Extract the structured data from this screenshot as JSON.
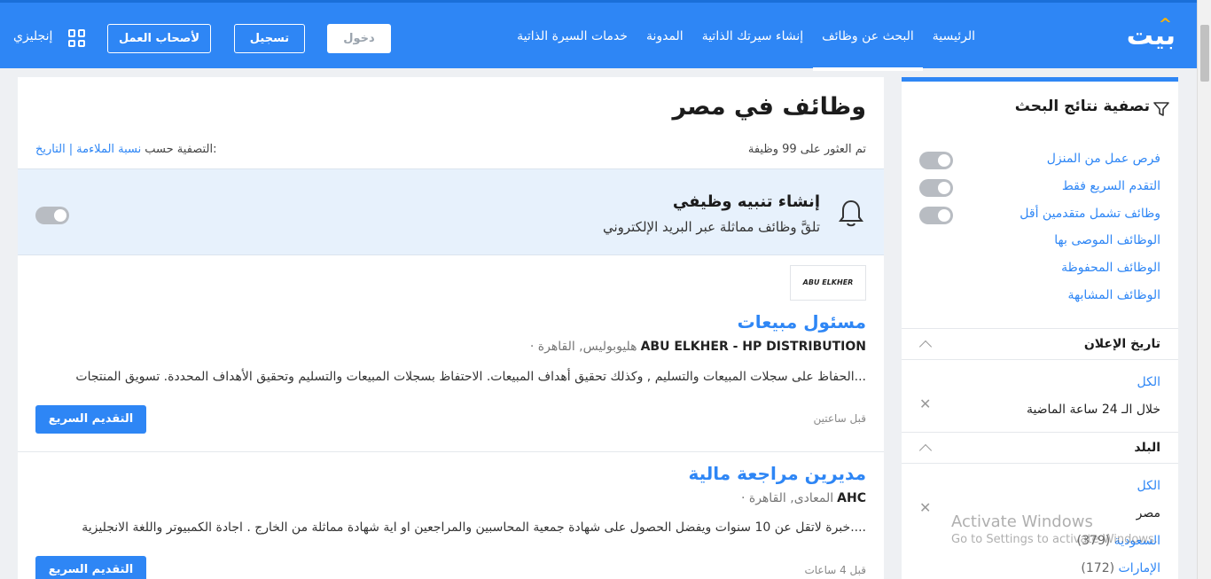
{
  "header": {
    "logo": "بيت",
    "nav": [
      "الرئيسية",
      "البحث عن وظائف",
      "إنشاء سيرتك الذاتية",
      "المدونة",
      "خدمات السيرة الذاتية"
    ],
    "active_nav_index": 1,
    "login": "دخول",
    "register": "تسجيل",
    "employers": "لأصحاب العمل",
    "language": "إنجليزي"
  },
  "main": {
    "title": "وظائف في مصر",
    "found": "تم العثور على 99 وظيفة",
    "sort_label": "التصفية حسب:",
    "sort_relevance": "نسبة الملاءمة",
    "sort_separator": "|",
    "sort_date": "التاريخ",
    "alert": {
      "title": "إنشاء تنبيه وظيفي",
      "subtitle": "تلقَّ وظائف مماثلة عبر البريد الإلكتروني"
    },
    "jobs": [
      {
        "logo_text": "ABU ELKHER",
        "title": "مسئول مبيعات",
        "company": "ABU ELKHER - HP DISTRIBUTION",
        "location": "· هليوبوليس, القاهرة",
        "description": "الحفاظ على سجلات المبيعات والتسليم , وكذلك تحقيق أهداف المبيعات. الاحتفاظ بسجلات المبيعات والتسليم وتحقيق الأهداف المحددة. تسويق المنتجات...",
        "time": "قبل ساعتين",
        "apply": "التقديم السريع"
      },
      {
        "title": "مديرين مراجعة مالية",
        "company": "AHC",
        "location": "· المعادى, القاهرة",
        "description": "خبرة لاتقل عن 10 سنوات ويفضل الحصول على شهادة جمعية المحاسبين والمراجعين او اية شهادة مماثلة من الخارج . اجادة الكمبيوتر واللغة الانجليزية....",
        "time": "قبل 4 ساعات",
        "apply": "التقديم السريع"
      }
    ]
  },
  "sidebar": {
    "title": "تصفية نتائج البحث",
    "toggles": [
      "فرص عمل من المنزل",
      "التقدم السريع فقط",
      "وظائف تشمل متقدمين أقل"
    ],
    "links": [
      "الوظائف الموصى بها",
      "الوظائف المحفوظة",
      "الوظائف المشابهة"
    ],
    "date_section": {
      "label": "تاريخ الإعلان",
      "all": "الكل",
      "selected": "خلال الـ 24 ساعة الماضية"
    },
    "country_section": {
      "label": "البلد",
      "all": "الكل",
      "selected": "مصر",
      "options": [
        {
          "name": "السعودية",
          "count": "(379)"
        },
        {
          "name": "الإمارات",
          "count": "(172)"
        }
      ]
    }
  },
  "watermark": {
    "line1": "Activate Windows",
    "line2": "Go to Settings to activate Windows."
  }
}
